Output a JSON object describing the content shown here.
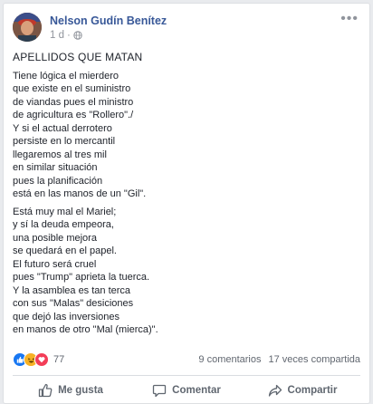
{
  "post": {
    "author": "Nelson Gudín Benítez",
    "time": "1 d",
    "separator": "·",
    "title": "APELLIDOS QUE MATAN",
    "stanzas": [
      [
        "Tiene lógica el mierdero",
        "que existe en el suministro",
        "de viandas pues el ministro",
        "de agricultura es \"Rollero\"./",
        "Y si el actual derrotero",
        "persiste en lo mercantil",
        "llegaremos al tres mil",
        "en similar situación",
        "pues la planificación",
        "está en las manos de un \"Gil\"."
      ],
      [
        "Está muy mal el Mariel;",
        "y sí la deuda empeora,",
        "una posible mejora",
        "se quedará en el papel.",
        "El futuro será cruel",
        "pues \"Trump\" aprieta la tuerca.",
        "Y la asamblea es tan terca",
        "con sus \"Malas\" desiciones",
        "que dejó las inversiones",
        "en manos de otro \"Mal (mierca)\"."
      ]
    ]
  },
  "stats": {
    "reactions_count": "77",
    "comments": "9 comentarios",
    "shares": "17 veces compartida"
  },
  "actions": {
    "like": "Me gusta",
    "comment": "Comentar",
    "share": "Compartir"
  },
  "colors": {
    "author": "#385898",
    "like_reaction": "#1877f2",
    "haha_reaction": "#f7b125",
    "love_reaction": "#f33e58"
  },
  "icons": [
    "globe-icon",
    "more-icon",
    "like-reaction-icon",
    "haha-reaction-icon",
    "love-reaction-icon",
    "thumbs-up-icon",
    "comment-icon",
    "share-icon"
  ]
}
